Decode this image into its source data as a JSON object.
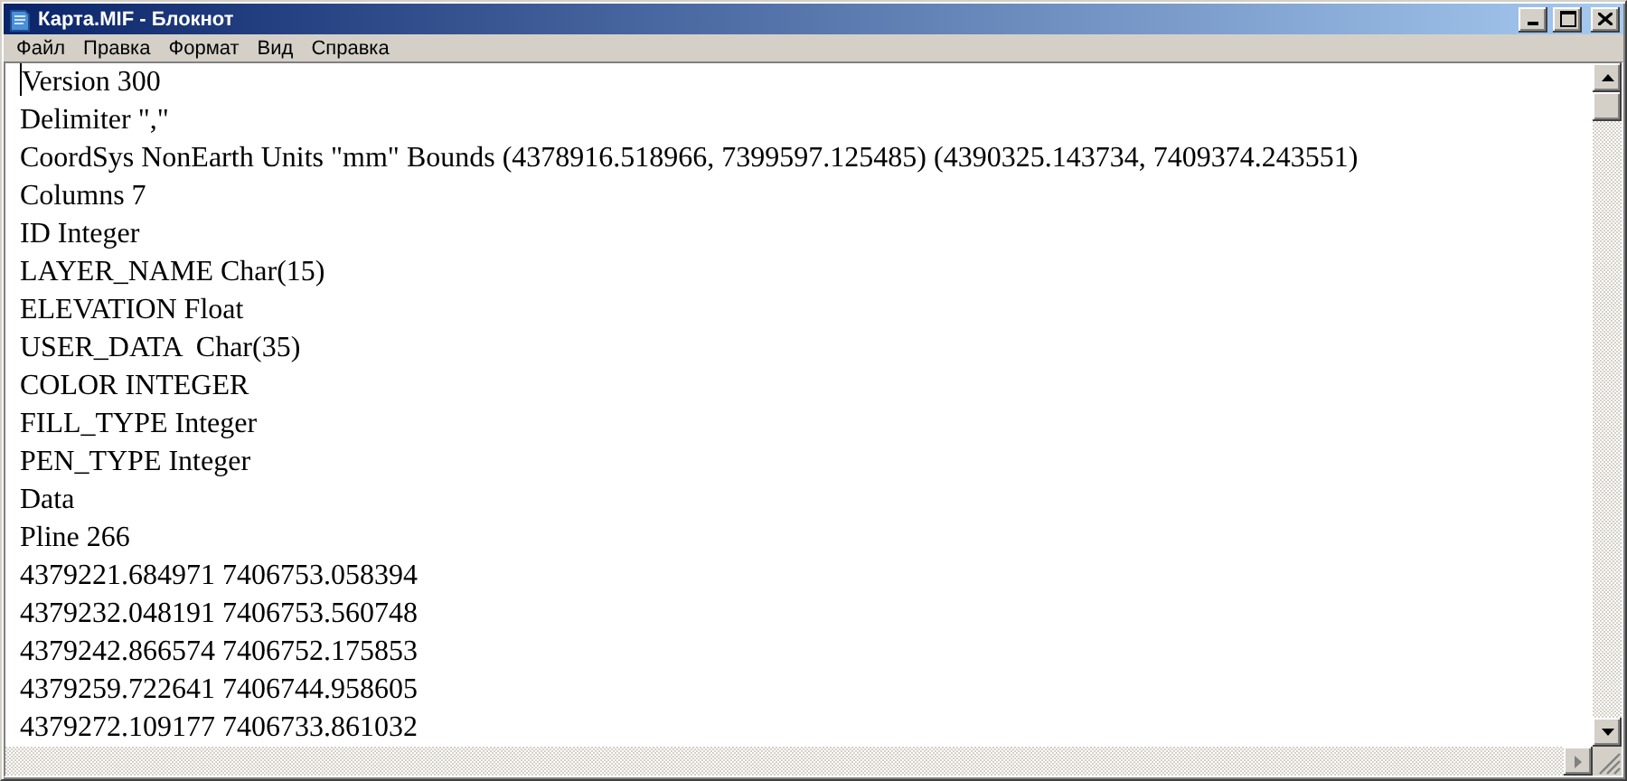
{
  "window": {
    "title": "Карта.MIF - Блокнот"
  },
  "menu": [
    "Файл",
    "Правка",
    "Формат",
    "Вид",
    "Справка"
  ],
  "document": {
    "lines": [
      "Version 300",
      "Delimiter \",\"",
      "CoordSys NonEarth Units \"mm\" Bounds (4378916.518966, 7399597.125485) (4390325.143734, 7409374.243551)",
      "Columns 7",
      "ID Integer",
      "LAYER_NAME Char(15)",
      "ELEVATION Float",
      "USER_DATA  Char(35)",
      "COLOR INTEGER",
      "FILL_TYPE Integer",
      "PEN_TYPE Integer",
      "Data",
      "Pline 266",
      "4379221.684971 7406753.058394",
      "4379232.048191 7406753.560748",
      "4379242.866574 7406752.175853",
      "4379259.722641 7406744.958605",
      "4379272.109177 7406733.861032"
    ]
  }
}
